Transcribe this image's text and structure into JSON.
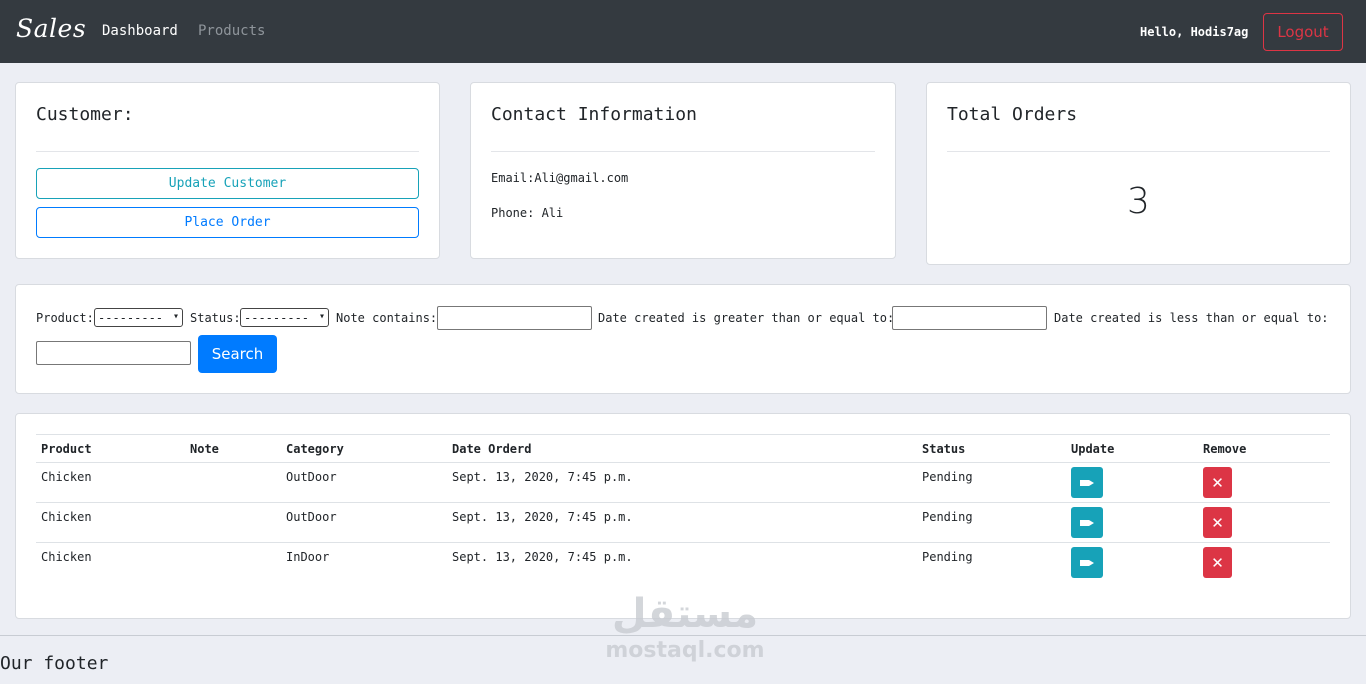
{
  "nav": {
    "brand": "Sales",
    "links": [
      "Dashboard",
      "Products"
    ],
    "greeting": "Hello, Hodis7ag",
    "logout": "Logout"
  },
  "customer": {
    "title": "Customer:",
    "update_label": "Update Customer",
    "place_order_label": "Place Order"
  },
  "contact": {
    "title": "Contact Information",
    "email": "Email:Ali@gmail.com",
    "phone": "Phone: Ali"
  },
  "orders": {
    "title": "Total Orders",
    "count": "3"
  },
  "filter": {
    "product_label": "Product:",
    "product_value": "---------",
    "status_label": "Status:",
    "status_value": "---------",
    "note_label": "Note contains:",
    "date_gte_label": "Date created is greater than or equal to:",
    "date_lte_label": "Date created is less than or equal to:",
    "search_label": "Search"
  },
  "table": {
    "headers": [
      "Product",
      "Note",
      "Category",
      "Date Orderd",
      "Status",
      "Update",
      "Remove"
    ],
    "rows": [
      {
        "product": "Chicken",
        "note": "",
        "category": "OutDoor",
        "date": "Sept. 13, 2020, 7:45 p.m.",
        "status": "Pending"
      },
      {
        "product": "Chicken",
        "note": "",
        "category": "OutDoor",
        "date": "Sept. 13, 2020, 7:45 p.m.",
        "status": "Pending"
      },
      {
        "product": "Chicken",
        "note": "",
        "category": "InDoor",
        "date": "Sept. 13, 2020, 7:45 p.m.",
        "status": "Pending"
      }
    ],
    "remove_glyph": "✕"
  },
  "footer": {
    "text": "Our footer"
  },
  "watermark": {
    "arabic": "مستقل",
    "latin": "mostaql.com"
  },
  "colors": {
    "navbar": "#343a40",
    "info": "#17a2b8",
    "primary": "#007bff",
    "danger": "#dc3545"
  }
}
